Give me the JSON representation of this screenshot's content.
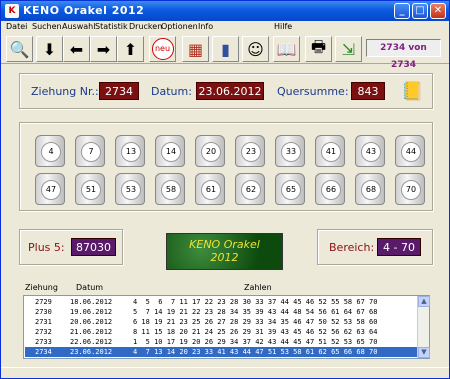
{
  "window": {
    "title": "KENO Orakel 2012",
    "icon": "K"
  },
  "title_buttons": {
    "minimize": "_",
    "maximize": "□",
    "close": "✕"
  },
  "menu": [
    "Datei",
    "Suchen",
    "Auswahl",
    "Statistik",
    "Drucken",
    "Optionen",
    "Info",
    "Hilfe"
  ],
  "toolbar": {
    "icons": [
      "search-icon",
      "arrow-down-icon",
      "arrow-left-icon",
      "arrow-right-icon",
      "arrow-up-icon",
      "new-icon",
      "grid-icon",
      "chart-icon",
      "face-icon",
      "book-icon",
      "printer-icon",
      "exit-icon"
    ],
    "new_label": "neu",
    "counter": "2734 von 2734"
  },
  "info": {
    "ziehung_label": "Ziehung Nr.:",
    "ziehung_value": "2734",
    "datum_label": "Datum:",
    "datum_value": "23.06.2012",
    "quersumme_label": "Quersumme:",
    "quersumme_value": "843"
  },
  "balls": [
    "4",
    "7",
    "13",
    "14",
    "20",
    "23",
    "33",
    "41",
    "43",
    "44",
    "47",
    "51",
    "53",
    "58",
    "61",
    "62",
    "65",
    "66",
    "68",
    "70"
  ],
  "plus5": {
    "label": "Plus 5:",
    "value": "87030"
  },
  "logo": {
    "line1": "KENO Orakel",
    "line2": "2012"
  },
  "bereich": {
    "label": "Bereich:",
    "value": "4 - 70"
  },
  "table": {
    "headers": {
      "ziehung": "Ziehung",
      "datum": "Datum",
      "zahlen": "Zahlen"
    },
    "rows": [
      {
        "nr": "2729",
        "datum": "18.06.2012",
        "zahlen": "4  5  6  7 11 17 22 23 28 30 33 37 44 45 46 52 55 58 67 70"
      },
      {
        "nr": "2730",
        "datum": "19.06.2012",
        "zahlen": "5  7 14 19 21 22 23 28 34 35 39 43 44 48 54 56 61 64 67 68"
      },
      {
        "nr": "2731",
        "datum": "20.06.2012",
        "zahlen": "6 18 19 21 23 25 26 27 28 29 33 34 35 46 47 50 52 53 58 60"
      },
      {
        "nr": "2732",
        "datum": "21.06.2012",
        "zahlen": "8 11 15 18 20 21 24 25 26 29 31 39 43 45 46 52 56 62 63 64"
      },
      {
        "nr": "2733",
        "datum": "22.06.2012",
        "zahlen": "1  5 10 17 19 20 26 29 34 37 42 43 44 45 47 51 52 53 65 70"
      },
      {
        "nr": "2734",
        "datum": "23.06.2012",
        "zahlen": "4  7 13 14 20 23 33 41 43 44 47 51 53 58 61 62 65 66 68 70"
      }
    ]
  },
  "colors": {
    "title_blue": "#0a5ae0",
    "value_red": "#7a1010",
    "accent_purple": "#5a1a6a",
    "label_blue": "#1a3a8a",
    "selection": "#316ac5"
  }
}
